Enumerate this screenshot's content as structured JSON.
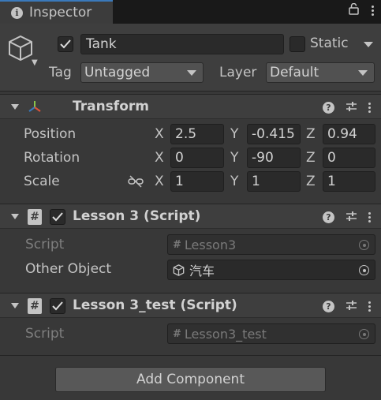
{
  "tab": {
    "title": "Inspector"
  },
  "gameobject": {
    "active": true,
    "name": "Tank",
    "static_label": "Static",
    "tag_label": "Tag",
    "tag_value": "Untagged",
    "layer_label": "Layer",
    "layer_value": "Default"
  },
  "transform": {
    "title": "Transform",
    "rows": [
      {
        "label": "Position",
        "x": "2.5",
        "y": "-0.415",
        "z": "0.94"
      },
      {
        "label": "Rotation",
        "x": "0",
        "y": "-90",
        "z": "0"
      },
      {
        "label": "Scale",
        "x": "1",
        "y": "1",
        "z": "1"
      }
    ],
    "axes": {
      "x": "X",
      "y": "Y",
      "z": "Z"
    }
  },
  "components": [
    {
      "title": "Lesson 3 (Script)",
      "enabled": true,
      "script_label": "Script",
      "script_value": "Lesson3",
      "field_label": "Other Object",
      "field_value": "汽车"
    },
    {
      "title": "Lesson 3_test (Script)",
      "enabled": true,
      "script_label": "Script",
      "script_value": "Lesson3_test"
    }
  ],
  "add_component_label": "Add Component",
  "icons": [
    "info-icon",
    "lock-icon",
    "kebab-menu-icon",
    "cube-icon",
    "transform-axes-icon",
    "help-icon",
    "preset-sliders-icon",
    "link-icon",
    "script-hash-icon",
    "object-picker-icon"
  ],
  "colors": {
    "background": "#383838",
    "header": "#3e3e3e",
    "tab_accent": "#3a79bb",
    "field": "#2a2a2a"
  }
}
